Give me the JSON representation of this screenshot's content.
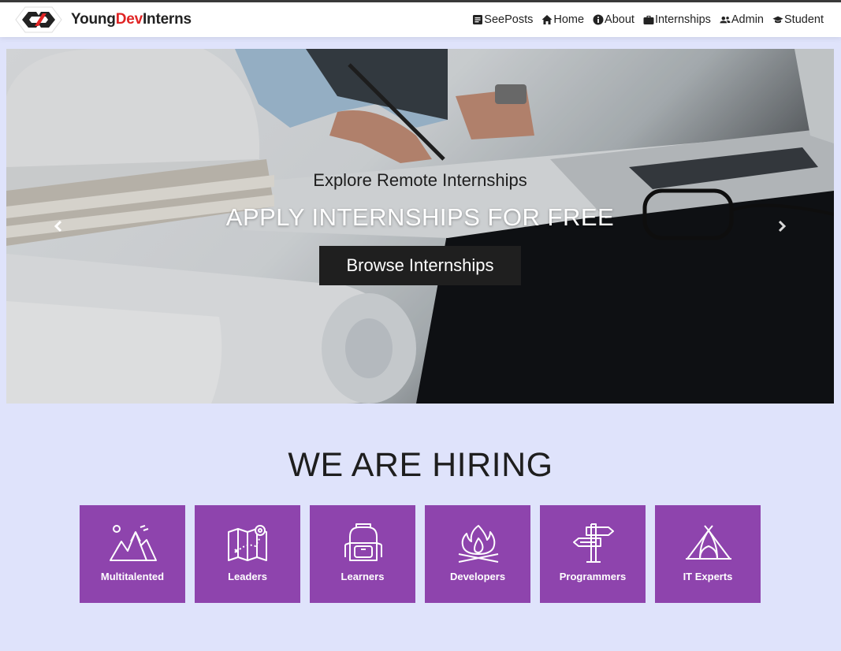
{
  "brand": {
    "name_part1": "Young",
    "name_part2": "Dev",
    "name_part3": "Interns",
    "accent": "#e02424"
  },
  "nav": [
    {
      "label": "SeePosts",
      "icon": "posts-icon"
    },
    {
      "label": "Home",
      "icon": "home-icon"
    },
    {
      "label": "About",
      "icon": "info-icon"
    },
    {
      "label": "Internships",
      "icon": "briefcase-icon"
    },
    {
      "label": "Admin",
      "icon": "users-icon"
    },
    {
      "label": "Student",
      "icon": "graduation-cap-icon"
    }
  ],
  "hero": {
    "subtitle": "Explore Remote Internships",
    "title": "APPLY INTERNSHIPS FOR FREE",
    "button_label": "Browse Internships"
  },
  "hiring": {
    "title": "WE ARE HIRING",
    "card_color": "#8e44ad",
    "cards": [
      {
        "label": "Multitalented",
        "icon": "mountains-icon"
      },
      {
        "label": "Leaders",
        "icon": "map-icon"
      },
      {
        "label": "Learners",
        "icon": "backpack-icon"
      },
      {
        "label": "Developers",
        "icon": "campfire-icon"
      },
      {
        "label": "Programmers",
        "icon": "signpost-icon"
      },
      {
        "label": "IT Experts",
        "icon": "tent-icon"
      }
    ]
  },
  "colors": {
    "page_bg": "#dfe3fb",
    "navbar_bg": "#ffffff",
    "button_bg": "#1f1f1f"
  }
}
